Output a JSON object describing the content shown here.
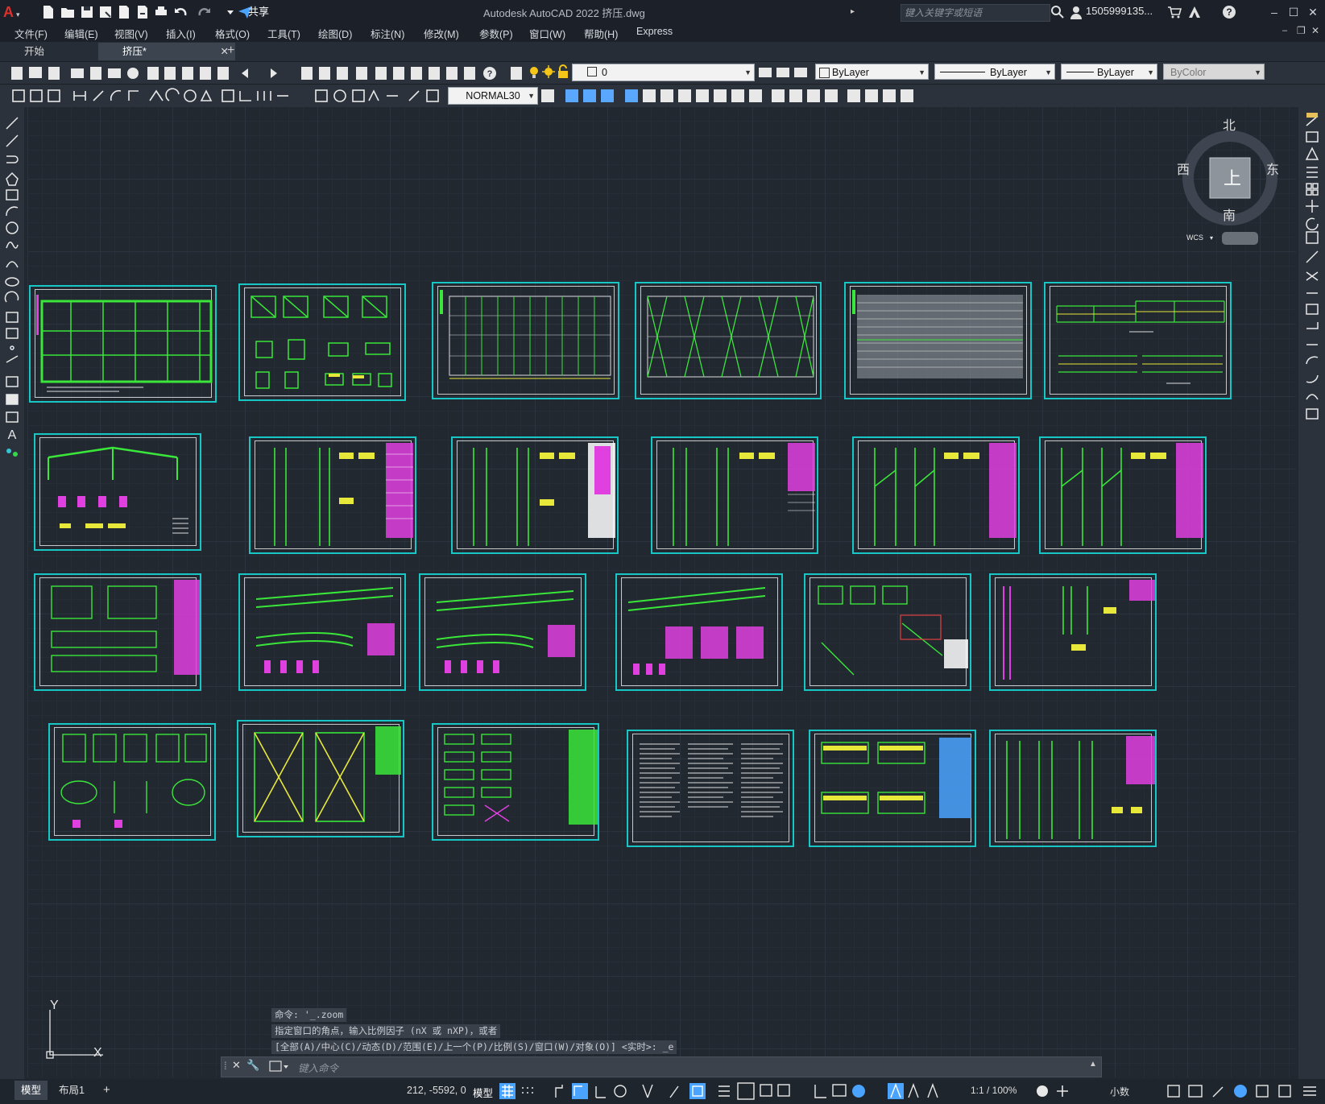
{
  "app": {
    "title": "Autodesk AutoCAD 2022    挤压.dwg",
    "logo_letter": "A",
    "share_label": "共享",
    "search_placeholder": "键入关键字或短语",
    "user": "1505999135..."
  },
  "menu": [
    "文件(F)",
    "编辑(E)",
    "视图(V)",
    "插入(I)",
    "格式(O)",
    "工具(T)",
    "绘图(D)",
    "标注(N)",
    "修改(M)",
    "参数(P)",
    "窗口(W)",
    "帮助(H)",
    "Express"
  ],
  "tabs": {
    "start": "开始",
    "file": "挤压*",
    "new_tab": "+"
  },
  "layers": {
    "current": "0"
  },
  "properties": {
    "color": "ByLayer",
    "linetype": "ByLayer",
    "lineweight": "ByLayer",
    "plotstyle": "ByColor"
  },
  "dimstyle": "NORMAL30",
  "viewcube": {
    "north": "北",
    "south": "南",
    "east": "东",
    "west": "西",
    "top": "上",
    "wcs": "WCS"
  },
  "ucs": {
    "x": "X",
    "y": "Y"
  },
  "command": {
    "history": [
      "命令: '_.zoom",
      "指定窗口的角点，输入比例因子 (nX 或 nXP)，或者",
      "[全部(A)/中心(C)/动态(D)/范围(E)/上一个(P)/比例(S)/窗口(W)/对象(O)] <实时>: _e"
    ],
    "input_placeholder": "键入命令"
  },
  "layout_tabs": [
    "模型",
    "布局1"
  ],
  "status": {
    "coords": "212, -5592, 0",
    "model_label": "模型",
    "scale": "1:1 / 100%",
    "units": "小数"
  },
  "colors": {
    "frame": "#19c6c6",
    "green": "#39e639",
    "magenta": "#e040e0",
    "yellow": "#e8e83a",
    "background": "#212830"
  }
}
